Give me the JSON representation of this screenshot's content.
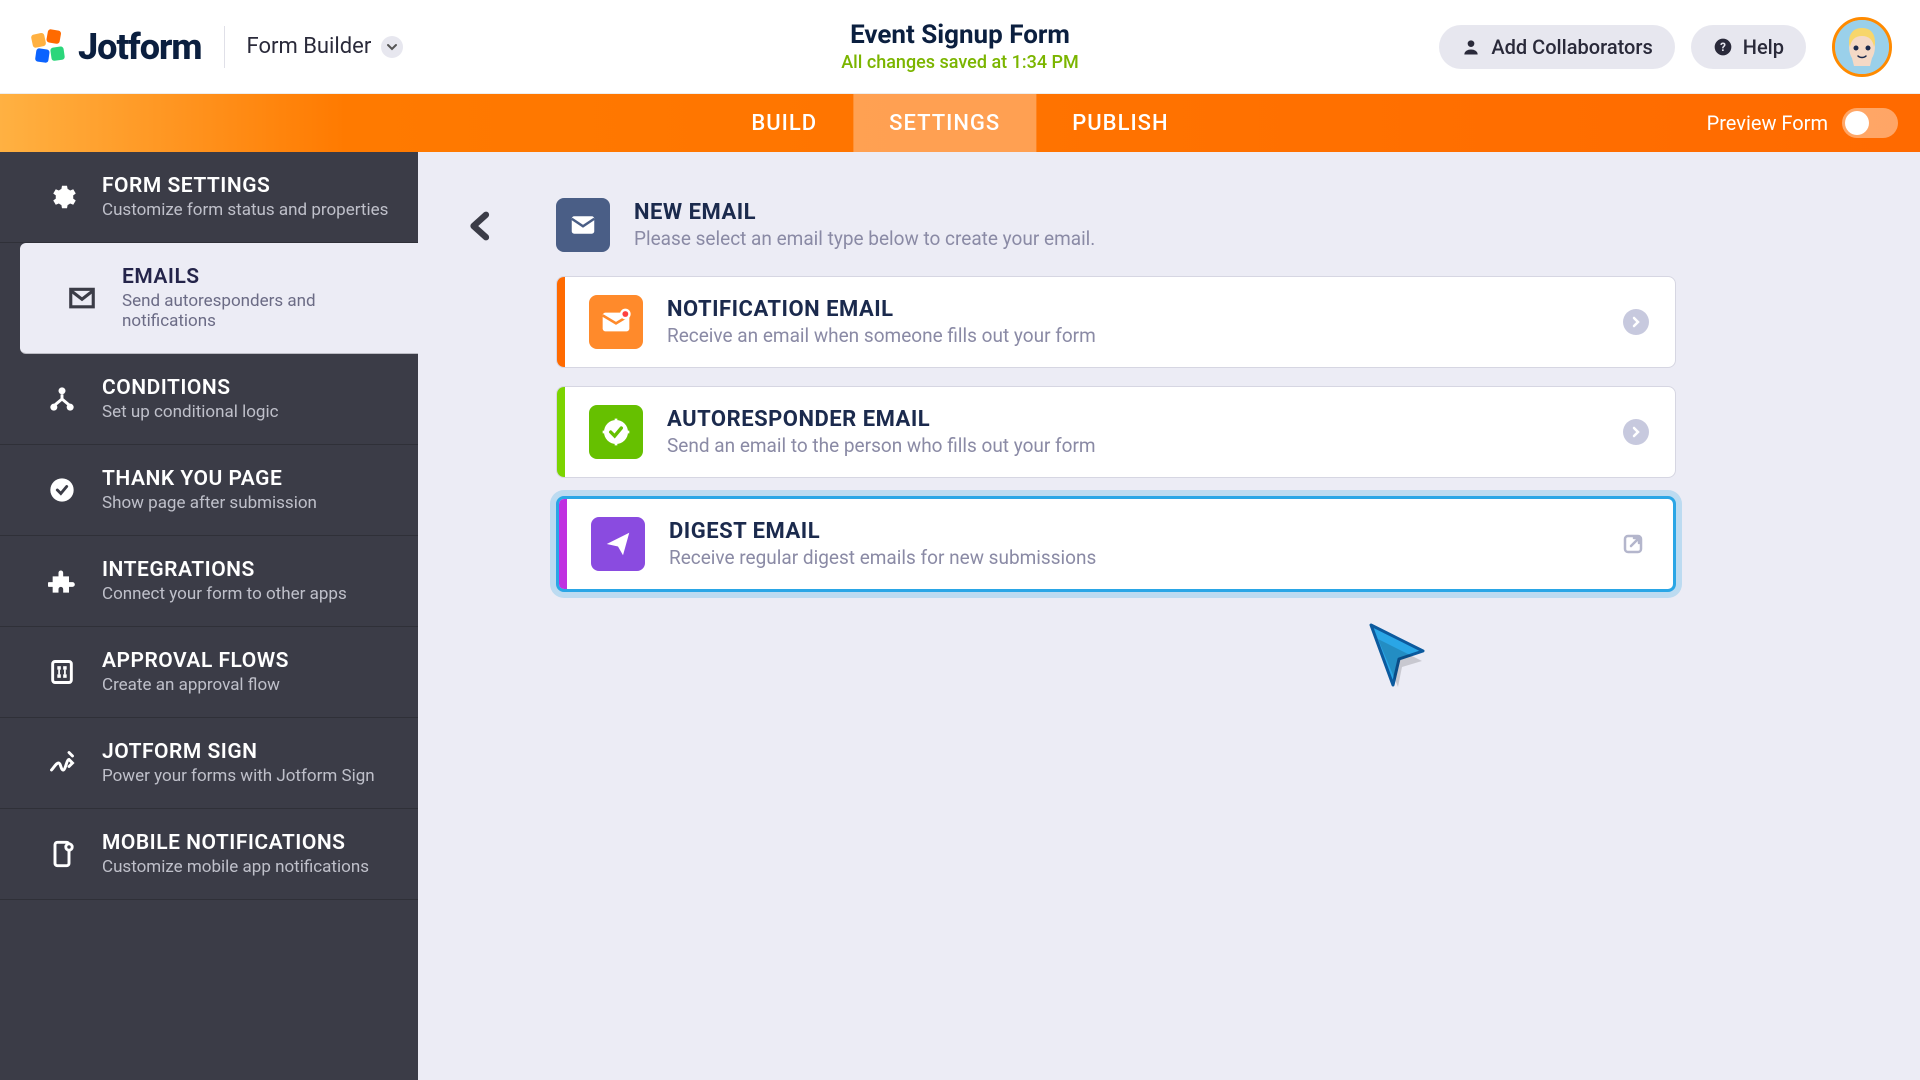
{
  "header": {
    "logo_text": "Jotform",
    "form_builder_label": "Form Builder",
    "form_title": "Event Signup Form",
    "save_status": "All changes saved at 1:34 PM",
    "add_collaborators": "Add Collaborators",
    "help": "Help"
  },
  "tabs": {
    "build": "BUILD",
    "settings": "SETTINGS",
    "publish": "PUBLISH",
    "preview": "Preview Form"
  },
  "sidebar": [
    {
      "title": "FORM SETTINGS",
      "desc": "Customize form status and properties",
      "icon": "gear"
    },
    {
      "title": "EMAILS",
      "desc": "Send autoresponders and notifications",
      "icon": "envelope",
      "selected": true
    },
    {
      "title": "CONDITIONS",
      "desc": "Set up conditional logic",
      "icon": "branch"
    },
    {
      "title": "THANK YOU PAGE",
      "desc": "Show page after submission",
      "icon": "check"
    },
    {
      "title": "INTEGRATIONS",
      "desc": "Connect your form to other apps",
      "icon": "puzzle"
    },
    {
      "title": "APPROVAL FLOWS",
      "desc": "Create an approval flow",
      "icon": "flow"
    },
    {
      "title": "JOTFORM SIGN",
      "desc": "Power your forms with Jotform Sign",
      "icon": "sign"
    },
    {
      "title": "MOBILE NOTIFICATIONS",
      "desc": "Customize mobile app notifications",
      "icon": "mobile"
    }
  ],
  "main": {
    "header": {
      "title": "NEW EMAIL",
      "desc": "Please select an email type below to create your email."
    },
    "cards": [
      {
        "title": "NOTIFICATION EMAIL",
        "desc": "Receive an email when someone fills out your form",
        "accent": "#ff6a00",
        "icon_bg": "#ff8a2b",
        "icon": "mail-alert",
        "action": "chevron"
      },
      {
        "title": "AUTORESPONDER EMAIL",
        "desc": "Send an email to the person who fills out your form",
        "accent": "#66c000",
        "icon_bg": "#66c000",
        "icon": "clock-check",
        "action": "chevron"
      },
      {
        "title": "DIGEST EMAIL",
        "desc": "Receive regular digest emails for new submissions",
        "accent": "#b030d8",
        "icon_bg": "#8a4be0",
        "icon": "send",
        "action": "external",
        "highlight": true
      }
    ]
  }
}
